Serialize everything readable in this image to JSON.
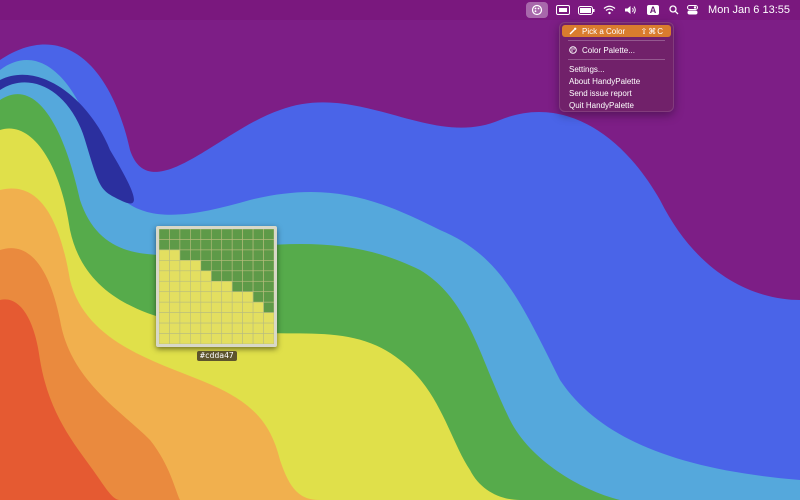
{
  "menubar": {
    "icons": [
      "handypalette-icon",
      "screen-mirroring-icon",
      "battery-icon",
      "wifi-icon",
      "volume-icon",
      "keyboard-input-icon",
      "search-icon",
      "control-center-icon"
    ],
    "input_source": "A",
    "clock": "Mon Jan 6  13:55"
  },
  "menu": {
    "items": [
      {
        "label": "Pick a Color",
        "shortcut": "⇧⌘C",
        "icon": "eyedropper-icon",
        "highlighted": true
      },
      {
        "label": "Color Palette...",
        "icon": "palette-icon"
      },
      {
        "label": "Settings..."
      },
      {
        "label": "About HandyPalette"
      },
      {
        "label": "Send issue report"
      },
      {
        "label": "Quit HandyPalette"
      }
    ]
  },
  "loupe": {
    "hex": "#cdda47",
    "colors": {
      "green": "#5e9a48",
      "yellow": "#e3df60",
      "grid": "#b9bd7e"
    }
  },
  "wallpaper": {
    "bands": [
      "#7d1e86",
      "#4a64e8",
      "#55a8dc",
      "#56ab4b",
      "#e0e04a",
      "#f1b04e",
      "#ea8a3e",
      "#e55a32"
    ]
  }
}
